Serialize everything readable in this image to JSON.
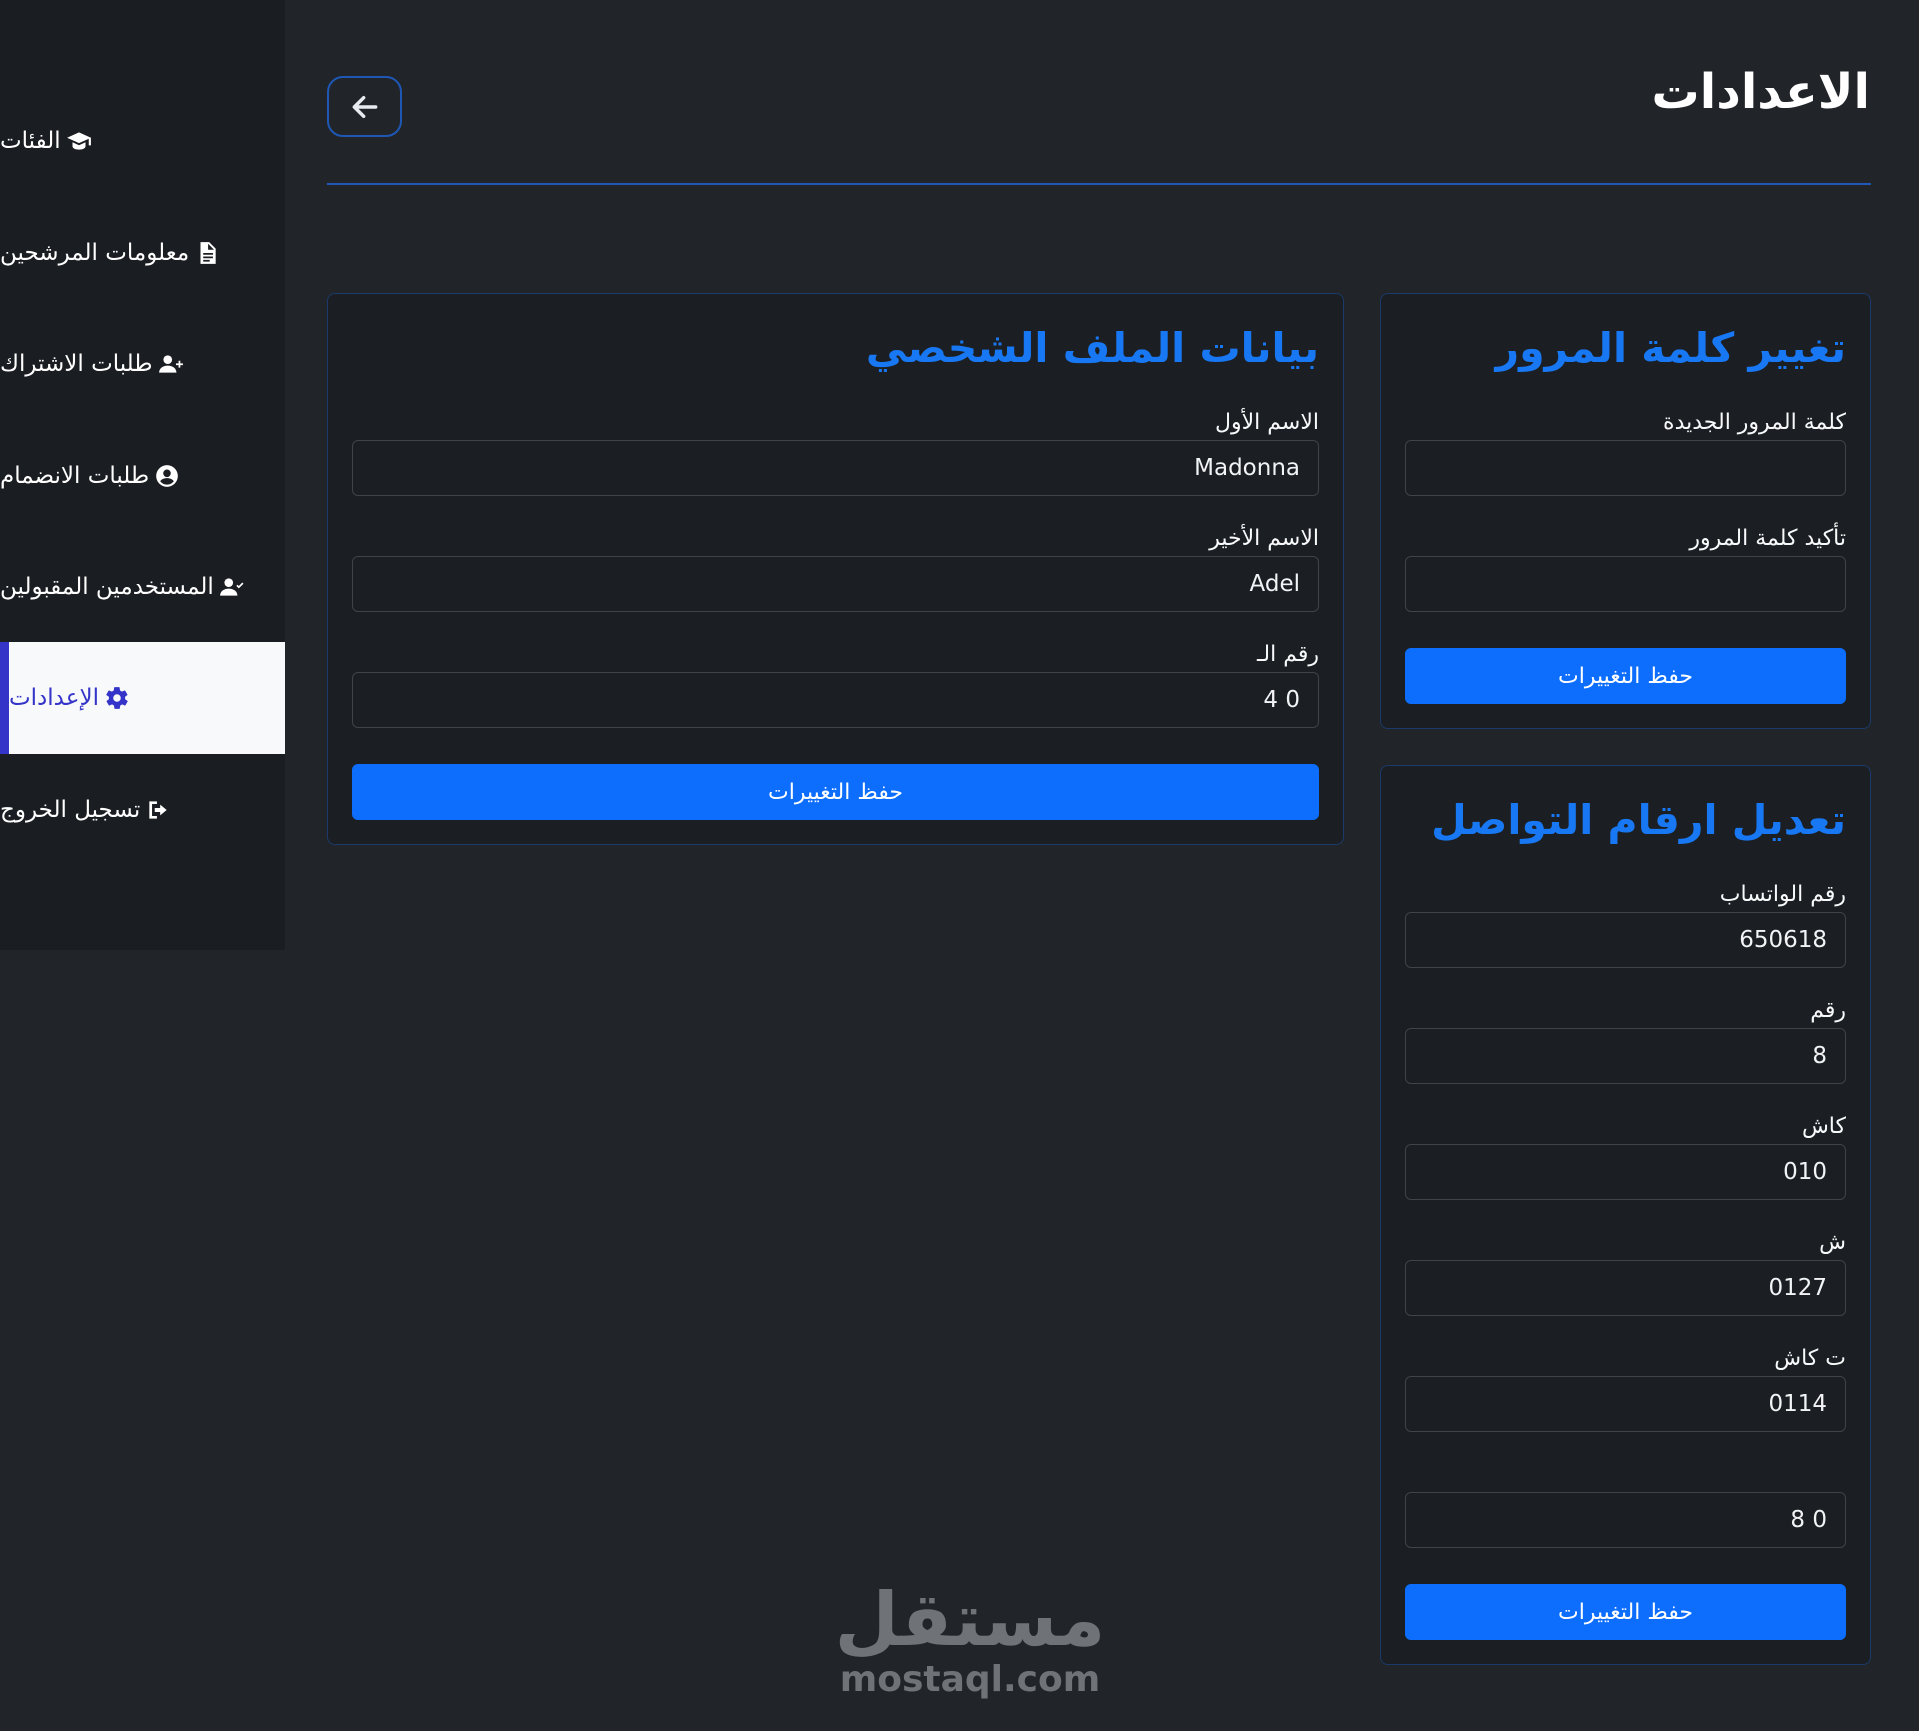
{
  "sidebar": {
    "items": [
      {
        "label": "الفئات",
        "icon": "graduation-cap-icon"
      },
      {
        "label": "معلومات المرشحين",
        "icon": "file-document-icon"
      },
      {
        "label": "طلبات الاشتراك",
        "icon": "user-plus-icon"
      },
      {
        "label": "طلبات الانضمام",
        "icon": "user-circle-icon"
      },
      {
        "label": "المستخدمين المقبولين",
        "icon": "user-check-icon"
      },
      {
        "label": "الإعدادات",
        "icon": "gear-icon",
        "active": true
      },
      {
        "label": "تسجيل الخروج",
        "icon": "sign-out-icon"
      }
    ]
  },
  "header": {
    "title": "الاعدادات",
    "back_icon": "arrow-left-icon"
  },
  "profile_card": {
    "title": "بيانات الملف الشخصي",
    "first_name_label": "الاسم الأول",
    "first_name_value": "Madonna",
    "last_name_label": "الاسم الأخير",
    "last_name_value": "Adel",
    "phone_label": "رقم الـ",
    "phone_value": "0 4",
    "save_label": "حفظ التغييرات"
  },
  "password_card": {
    "title": "تغيير كلمة المرور",
    "new_password_label": "كلمة المرور الجديدة",
    "new_password_value": "",
    "confirm_password_label": "تأكيد كلمة المرور",
    "confirm_password_value": "",
    "save_label": "حفظ التغييرات"
  },
  "contact_card": {
    "title": "تعديل ارقام التواصل",
    "fields": [
      {
        "label": "رقم الواتساب",
        "value": "650618"
      },
      {
        "label": "رقم",
        "value": "8"
      },
      {
        "label": "كاش",
        "value": "010"
      },
      {
        "label": "ش",
        "value": "0127"
      },
      {
        "label": "ت كاش",
        "value": "0114"
      },
      {
        "label": "",
        "value": "0 8"
      }
    ],
    "save_label": "حفظ التغييرات"
  },
  "watermark": {
    "arabic": "مستقل",
    "latin": "mostaql.com"
  },
  "colors": {
    "background": "#212529",
    "sidebar": "#1a1d21",
    "accent": "#0d6efd",
    "title_blue": "#1877f2",
    "active_text": "#3534c9"
  }
}
